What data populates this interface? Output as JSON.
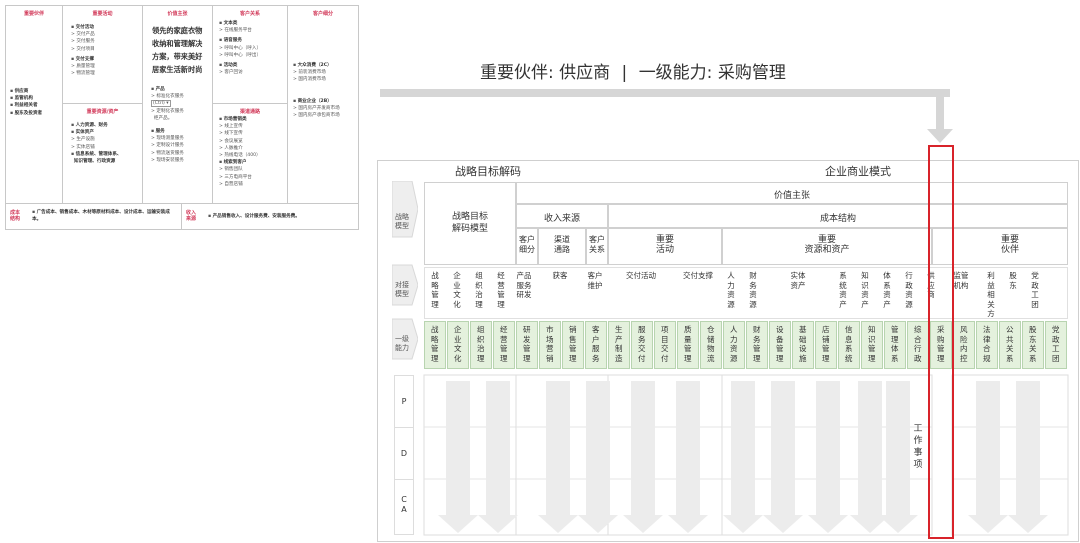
{
  "canvas": {
    "key_partners": {
      "header": "重要伙伴",
      "items": [
        "供应商",
        "监管机构",
        "利益相关者",
        "股东及投资者"
      ]
    },
    "key_activities": {
      "header": "重要活动",
      "groups": [
        {
          "title": "交付活动",
          "items": [
            "交付产品",
            "交付服务",
            "交付项目"
          ]
        },
        {
          "title": "交付支撑",
          "items": [
            "质量管理",
            "物流管理"
          ]
        }
      ]
    },
    "key_resources": {
      "header": "重要资源/资产",
      "groups": [
        {
          "title": "人力资源、财务",
          "items": []
        },
        {
          "title": "实体资产",
          "items": [
            "生产设施",
            "实体店铺"
          ]
        },
        {
          "title": "信息系统、管理体系、",
          "items": []
        },
        {
          "title": "知识管理、行政资源",
          "items": []
        }
      ]
    },
    "value_proposition": {
      "header": "价值主张",
      "text": [
        "领先的家庭衣物",
        "收纳和管理解决",
        "方案，带来美好",
        "居家生活新时尚"
      ],
      "groups": [
        {
          "title": "产品",
          "items": [
            "标准化衣服务",
            "(Ctrl) ▾",
            "定制化衣服务",
            "柜产品。"
          ]
        },
        {
          "title": "服务",
          "items": [
            "现场测量服务",
            "定制设计服务",
            "物流送货服务",
            "现场安装服务"
          ]
        }
      ]
    },
    "customer_relationships": {
      "header": "客户关系",
      "groups": [
        {
          "title": "文本类",
          "items": [
            "在线服务平台"
          ]
        },
        {
          "title": "语音服务",
          "items": [
            "呼叫中心（呼入）",
            "呼叫中心（呼出）"
          ]
        },
        {
          "title": "活动类",
          "items": [
            "客户回访"
          ]
        }
      ]
    },
    "channels": {
      "header": "渠道通路",
      "groups": [
        {
          "title": "市场营销类",
          "items": [
            "线上宣传",
            "线下宣传",
            "会议展览",
            "人脉推介",
            "热线电话（400）"
          ]
        },
        {
          "title": "线索到客户",
          "items": [
            "销售团队",
            "三方电商平台",
            "自营店铺"
          ]
        }
      ]
    },
    "customer_segments": {
      "header": "客户细分",
      "groups": [
        {
          "title": "大众消费（2C）",
          "items": [
            "前装消费市场",
            "国内消费市场"
          ]
        },
        {
          "title": "商业企业（2B）",
          "items": [
            "国内房产开发商市场",
            "国内房产承包商市场"
          ]
        }
      ]
    },
    "cost_structure": {
      "label": "成本\n结构",
      "text": "广告成本、销售成本、木材等原材料成本、设计成本、运输安装成本。"
    },
    "revenue_streams": {
      "label": "收入\n来源",
      "text": "产品销售收入、设计服务费、安装服务费。"
    }
  },
  "title": {
    "left": "重要伙伴: 供应商",
    "sep": "|",
    "right": "一级能力: 采购管理"
  },
  "framework": {
    "header_left": "战略目标解码",
    "header_right": "企业商业模式",
    "row_labels": [
      "战略\n模型",
      "对接\n模型",
      "一级\n能力"
    ],
    "strategy_model_label": "战略目标\n解码模型",
    "value_prop": "价值主张",
    "income_source": "收入来源",
    "cost_structure": "成本结构",
    "sub_headers": [
      "客户\n细分",
      "渠道\n通路",
      "客户\n关系",
      "重要\n活动",
      "重要\n资源和资产",
      "重要\n伙伴"
    ],
    "docking": [
      "战\n略\n管\n理",
      "企\n业\n文\n化",
      "组\n织\n治\n理",
      "经\n营\n管\n理",
      "产品\n服务\n研发",
      "获客",
      "客户\n维护",
      "交付活动",
      "交付支撑",
      "人\n力\n资\n源",
      "财\n务\n资\n源",
      "实体\n资产",
      "系\n统\n资\n产",
      "知\n识\n资\n产",
      "体\n系\n资\n产",
      "行\n政\n资\n源",
      "供\n应\n商",
      "监管\n机构",
      "利\n益\n相\n关\n方",
      "股\n东",
      "党\n政\n工\n团"
    ],
    "capabilities": [
      "战\n略\n管\n理",
      "企\n业\n文\n化",
      "组\n织\n治\n理",
      "经\n营\n管\n理",
      "研\n发\n管\n理",
      "市\n场\n营\n销",
      "销\n售\n管\n理",
      "客\n户\n服\n务",
      "生\n产\n制\n造",
      "服\n务\n交\n付",
      "项\n目\n交\n付",
      "质\n量\n管\n理",
      "仓\n储\n物\n流",
      "人\n力\n资\n源",
      "财\n务\n管\n理",
      "设\n备\n管\n理",
      "基\n础\n设\n施",
      "店\n铺\n管\n理",
      "信\n息\n系\n统",
      "知\n识\n管\n理",
      "管\n理\n体\n系",
      "综\n合\n行\n政",
      "采\n购\n管\n理",
      "风\n险\n内\n控",
      "法\n律\n合\n规",
      "公\n共\n关\n系",
      "股\n东\n关\n系",
      "党\n政\n工\n团"
    ],
    "pdca": [
      "P",
      "D",
      "C\nA"
    ],
    "work_items": "工\n作\n事\n项"
  },
  "colors": {
    "accent_red": "#d8232a",
    "header_pink": "#d23a5a",
    "green_fill": "#e4f1dd",
    "arrow_gray": "#d6d6d6"
  }
}
